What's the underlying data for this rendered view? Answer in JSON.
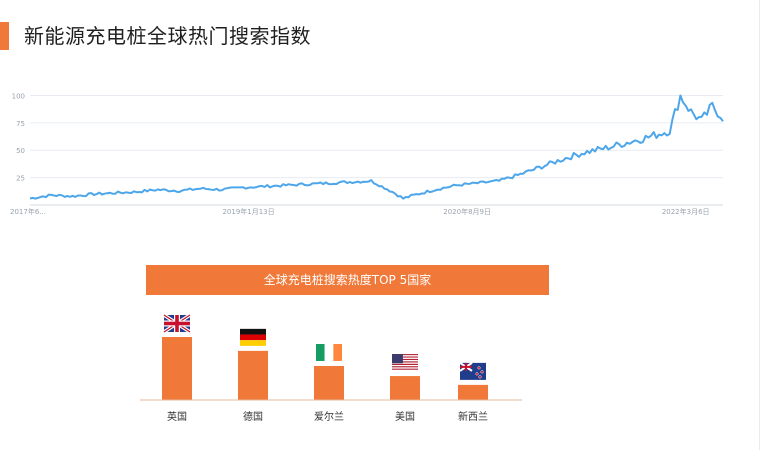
{
  "page": {
    "title": "新能源充电桩全球热门搜索指数"
  },
  "colors": {
    "accent": "#f07838",
    "line": "#4da6ea",
    "grid": "#e8ecf2",
    "tick": "#9aa3ad"
  },
  "chart_data": [
    {
      "type": "line",
      "title": "",
      "xlabel": "",
      "ylabel": "",
      "y_ticks": [
        "25",
        "50",
        "75",
        "100"
      ],
      "ylim": [
        0,
        105
      ],
      "x_tick_labels": [
        "2017年6...",
        "2019年1月13日",
        "2020年8月9日",
        "2022年3月6日"
      ],
      "x_tick_dates": [
        "2017-06-18",
        "2019-01-13",
        "2020-08-09",
        "2022-03-06"
      ],
      "xlim": [
        "2017-06-18",
        "2022-06-12"
      ],
      "grid": true,
      "series": [
        {
          "x": [
            "2017-06-18",
            "2017-08-13",
            "2017-10-08",
            "2017-12-03",
            "2018-01-28",
            "2018-03-25",
            "2018-05-20",
            "2018-07-15",
            "2018-09-09",
            "2018-11-04",
            "2018-12-30",
            "2019-02-24",
            "2019-04-21",
            "2019-06-16",
            "2019-08-11",
            "2019-10-06",
            "2019-12-01",
            "2020-01-26",
            "2020-02-23",
            "2020-03-22",
            "2020-05-17",
            "2020-07-12",
            "2020-09-06",
            "2020-11-01",
            "2020-12-27",
            "2021-02-21",
            "2021-04-18",
            "2021-06-13",
            "2021-08-08",
            "2021-10-03",
            "2021-11-28",
            "2022-01-23",
            "2022-02-20",
            "2022-03-20",
            "2022-04-17",
            "2022-05-15",
            "2022-06-12"
          ],
          "y": [
            6,
            9,
            8,
            10,
            11,
            12,
            14,
            13,
            15,
            14,
            16,
            17,
            18,
            19,
            20,
            21,
            22,
            12,
            6,
            9,
            14,
            18,
            20,
            22,
            28,
            35,
            42,
            48,
            52,
            57,
            62,
            68,
            100,
            85,
            77,
            90,
            80
          ]
        }
      ]
    },
    {
      "type": "bar",
      "title": "全球充电桩搜索热度TOP 5国家",
      "xlabel": "",
      "ylabel": "",
      "categories": [
        "英国",
        "德国",
        "爱尔兰",
        "美国",
        "新西兰"
      ],
      "values": [
        100,
        78,
        54,
        38,
        24
      ],
      "ylim": [
        0,
        100
      ],
      "flag_icons": [
        "uk-flag-icon",
        "germany-flag-icon",
        "ireland-flag-icon",
        "usa-flag-icon",
        "new-zealand-flag-icon"
      ]
    }
  ]
}
